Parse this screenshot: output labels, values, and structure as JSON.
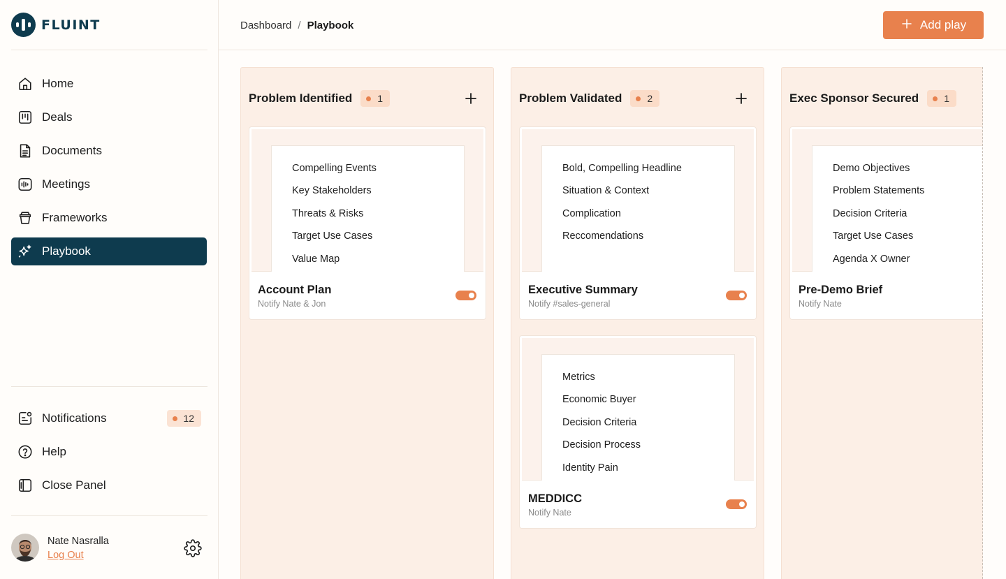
{
  "app": {
    "name": "FLUINT"
  },
  "sidebar": {
    "nav": [
      {
        "label": "Home",
        "icon": "home-icon"
      },
      {
        "label": "Deals",
        "icon": "deals-icon"
      },
      {
        "label": "Documents",
        "icon": "document-icon"
      },
      {
        "label": "Meetings",
        "icon": "waveform-icon"
      },
      {
        "label": "Frameworks",
        "icon": "frameworks-icon"
      },
      {
        "label": "Playbook",
        "icon": "sparkle-icon",
        "active": true
      }
    ],
    "footer_nav": [
      {
        "label": "Notifications",
        "icon": "notification-icon",
        "badge": "12"
      },
      {
        "label": "Help",
        "icon": "help-icon"
      },
      {
        "label": "Close Panel",
        "icon": "panel-icon"
      }
    ],
    "user": {
      "name": "Nate Nasralla",
      "logout": "Log Out"
    }
  },
  "header": {
    "breadcrumb": [
      "Dashboard",
      "Playbook"
    ],
    "breadcrumb_sep": "/",
    "add_button": "Add play"
  },
  "colors": {
    "accent": "#e8814d",
    "brand": "#0e3b4e",
    "column_bg": "#fcefe6"
  },
  "board": {
    "columns": [
      {
        "title": "Problem Identified",
        "count": "1",
        "cards": [
          {
            "title": "Account Plan",
            "notify": "Notify Nate & Jon",
            "enabled": true,
            "items": [
              "Compelling Events",
              "Key Stakeholders",
              "Threats & Risks",
              "Target Use Cases",
              "Value Map"
            ]
          }
        ]
      },
      {
        "title": "Problem Validated",
        "count": "2",
        "cards": [
          {
            "title": "Executive Summary",
            "notify": "Notify #sales-general",
            "enabled": true,
            "items": [
              "Bold, Compelling Headline",
              "Situation & Context",
              "Complication",
              "Reccomendations"
            ]
          },
          {
            "title": "MEDDICC",
            "notify": "Notify Nate",
            "enabled": true,
            "items": [
              "Metrics",
              "Economic Buyer",
              "Decision Criteria",
              "Decision Process",
              "Identity Pain"
            ]
          }
        ]
      },
      {
        "title": "Exec Sponsor Secured",
        "count": "1",
        "cards": [
          {
            "title": "Pre-Demo Brief",
            "notify": "Notify Nate",
            "enabled": true,
            "items": [
              "Demo Objectives",
              "Problem Statements",
              "Decision Criteria",
              "Target Use Cases",
              "Agenda X Owner"
            ]
          }
        ]
      }
    ]
  }
}
